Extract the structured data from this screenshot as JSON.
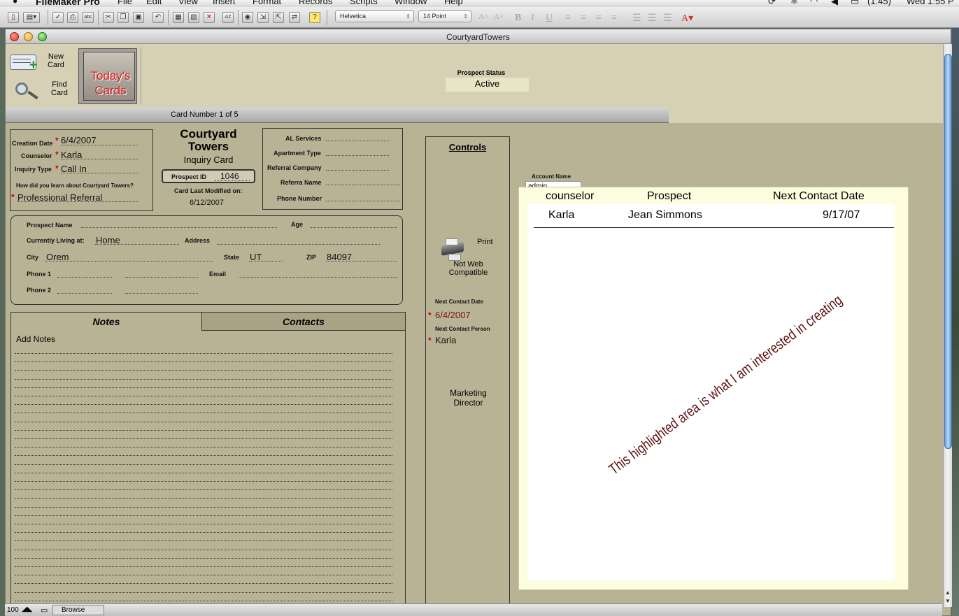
{
  "menubar": {
    "app": "FileMaker Pro",
    "items": [
      "File",
      "Edit",
      "View",
      "Insert",
      "Format",
      "Records",
      "Scripts",
      "Window",
      "Help"
    ],
    "battery": "(1:45)",
    "clock": "Wed 1:55 P"
  },
  "toolbar": {
    "font": "Helvetica",
    "size": "14 Point"
  },
  "window": {
    "title": "CourtyardTowers"
  },
  "nav": {
    "new_card": [
      "New",
      "Card"
    ],
    "find_card": [
      "Find",
      "Card"
    ],
    "todays_cards": [
      "Today's",
      "Cards"
    ]
  },
  "prospect_status": {
    "label": "Prospect Status",
    "value": "Active"
  },
  "card_number": "Card Number 1 of  5",
  "info": {
    "creation_date_label": "Creation Date",
    "creation_date": "6/4/2007",
    "counselor_label": "Counselor",
    "counselor": "Karla",
    "inquiry_type_label": "Inquiry Type",
    "inquiry_type": "Call In",
    "learn_label": "How did you learn about Courtyard Towers?",
    "learn_value": "Professional Referral"
  },
  "title_block": {
    "line1": "Courtyard",
    "line2": "Towers",
    "subtitle": "Inquiry Card",
    "prospect_id_label": "Prospect ID",
    "prospect_id": "1046",
    "modified_label": "Card Last Modified on:",
    "modified_value": "6/12/2007"
  },
  "services": {
    "labels": [
      "AL Services",
      "Apartment Type",
      "Referral Company",
      "Referra Name",
      "Phone Number"
    ]
  },
  "prospect": {
    "name_label": "Prospect Name",
    "age_label": "Age",
    "living_label": "Currently Living at:",
    "living_value": "Home",
    "address_label": "Address",
    "city_label": "City",
    "city_value": "Orem",
    "state_label": "State",
    "state_value": "UT",
    "zip_label": "ZIP",
    "zip_value": "84097",
    "phone1_label": "Phone 1",
    "phone2_label": "Phone 2",
    "email_label": "Email"
  },
  "tabs": {
    "notes": "Notes",
    "contacts": "Contacts"
  },
  "notes": {
    "add_label": "Add Notes"
  },
  "controls": {
    "title": "Controls",
    "print_label": "Print",
    "not_web": [
      "Not Web",
      "Compatible"
    ],
    "next_date_label": "Next Contact Date",
    "next_date": "6/4/2007",
    "next_person_label": "Next Contact Person",
    "next_person": "Karla",
    "marketing": [
      "Marketing",
      "Director"
    ]
  },
  "account": {
    "label": "Account Name",
    "value": "admin"
  },
  "portal": {
    "headers": [
      "counselor",
      "Prospect",
      "Next Contact Date"
    ],
    "row": [
      "Karla",
      "Jean Simmons",
      "9/17/07"
    ],
    "annotation": "This highlighted area is what I am interested in creating"
  },
  "statusbar": {
    "zoom": "100",
    "mode": "Browse"
  }
}
